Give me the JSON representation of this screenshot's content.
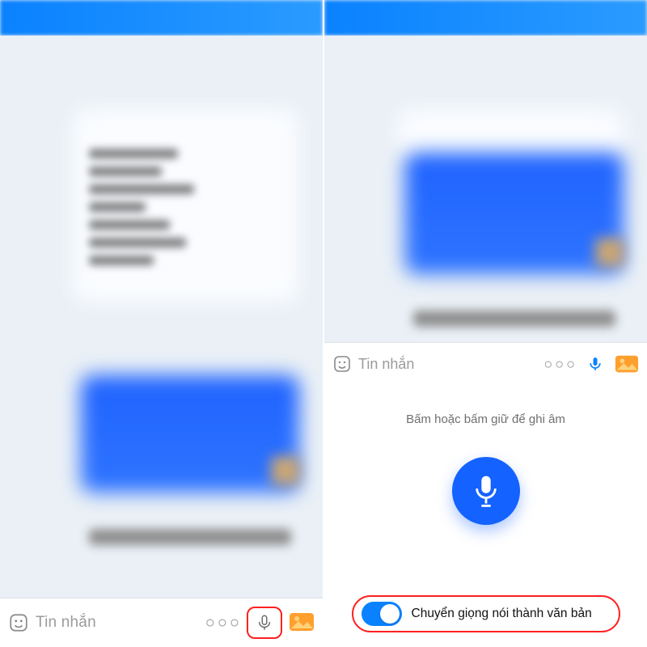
{
  "left": {
    "composer": {
      "placeholder": "Tin nhắn",
      "more_icon": "more-horizontal",
      "mic_icon": "mic",
      "gallery_icon": "photo",
      "smiley_icon": "smiley"
    }
  },
  "right": {
    "composer": {
      "placeholder": "Tin nhắn"
    },
    "voice_panel": {
      "hint": "Bấm hoặc bấm giữ để ghi âm",
      "toggle": {
        "label": "Chuyển giọng nói thành văn bản",
        "enabled": true
      }
    }
  },
  "colors": {
    "accent": "#1462ff",
    "highlight": "#ff2020",
    "toolbar": "#0a82ff"
  }
}
